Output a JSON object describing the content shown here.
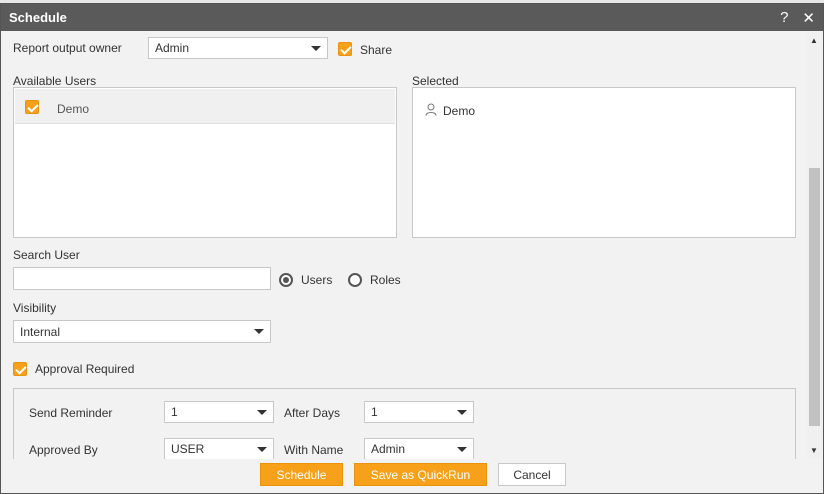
{
  "dialog": {
    "title": "Schedule",
    "help_label": "?",
    "close_label": "✕"
  },
  "owner": {
    "label": "Report output owner",
    "value": "Admin",
    "share_label": "Share"
  },
  "available_users": {
    "label": "Available Users",
    "items": [
      {
        "name": "Demo",
        "checked": true
      }
    ]
  },
  "selected": {
    "label": "Selected",
    "items": [
      {
        "name": "Demo"
      }
    ]
  },
  "search": {
    "label": "Search User",
    "value": "",
    "placeholder": "",
    "options": [
      "Users",
      "Roles"
    ],
    "selected_option": "Users"
  },
  "visibility": {
    "label": "Visibility",
    "value": "Internal"
  },
  "approval": {
    "label": "Approval Required",
    "checked": true,
    "send_reminder_label": "Send Reminder",
    "send_reminder_value": "1",
    "after_days_label": "After Days",
    "after_days_value": "1",
    "approved_by_label": "Approved By",
    "approved_by_value": "USER",
    "with_name_label": "With Name",
    "with_name_value": "Admin"
  },
  "footer": {
    "schedule_label": "Schedule",
    "quickrun_label": "Save as QuickRun",
    "cancel_label": "Cancel"
  },
  "colors": {
    "accent": "#f7a11a",
    "titlebar": "#5a5a5a"
  }
}
